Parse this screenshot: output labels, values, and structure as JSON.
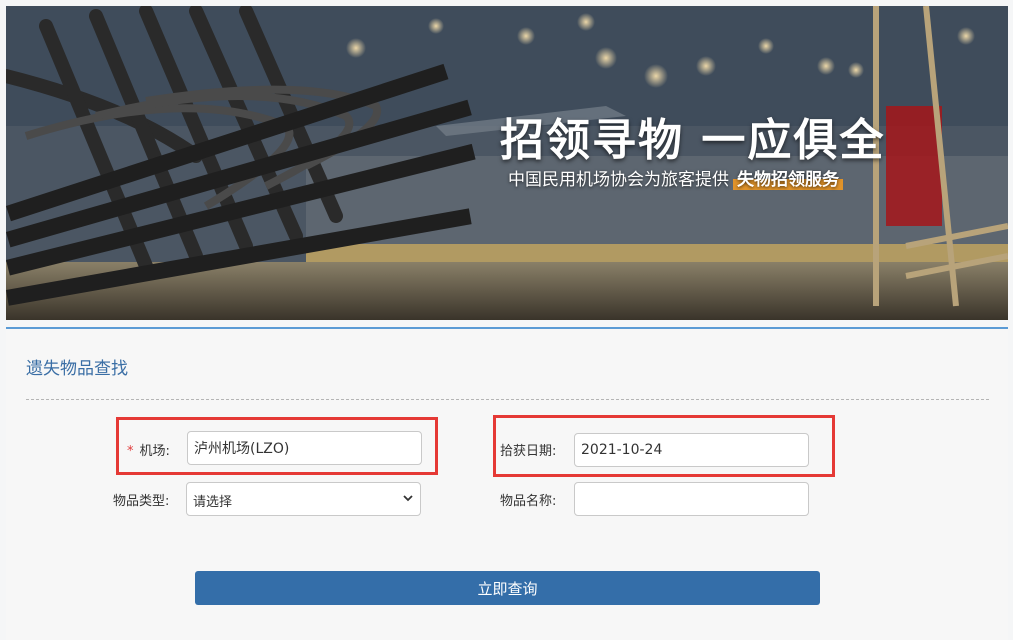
{
  "banner": {
    "title": "招领寻物 一应俱全",
    "subtitle": "中国民用机场协会为旅客提供",
    "subtitle_highlight": "失物招领服务"
  },
  "form": {
    "section_title": "遗失物品查找",
    "airport": {
      "label": "机场:",
      "required_mark": "*",
      "value": "泸州机场(LZO)"
    },
    "found_date": {
      "label": "拾获日期:",
      "value": "2021-10-24"
    },
    "item_type": {
      "label": "物品类型:",
      "selected": "请选择"
    },
    "item_name": {
      "label": "物品名称:",
      "value": ""
    },
    "submit_label": "立即查询"
  },
  "colors": {
    "accent": "#346ea9",
    "title": "#3a6ea5",
    "highlight_box": "#e53935",
    "banner_tag": "#e0932a"
  },
  "icons": {
    "select_arrow": "chevron-down-icon"
  }
}
